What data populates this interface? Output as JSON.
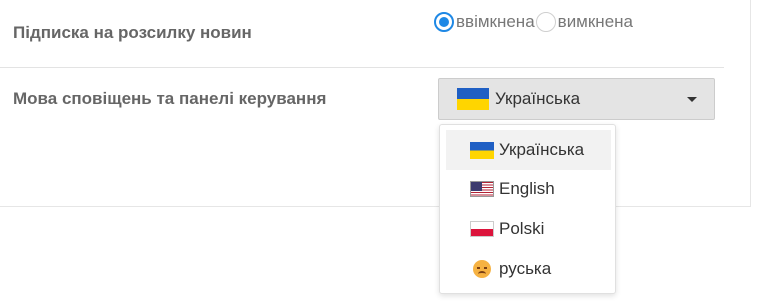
{
  "newsletter": {
    "label": "Підписка на розсилку новин",
    "options": [
      {
        "label": "ввімкнена",
        "checked": true
      },
      {
        "label": "вимкнена",
        "checked": false
      }
    ]
  },
  "language": {
    "label": "Мова сповіщень та панелі керування",
    "selected": {
      "label": "Українська",
      "icon": "flag-ukraine-icon"
    },
    "dropdown_open": true,
    "options": [
      {
        "label": "Українська",
        "icon": "flag-ukraine-icon",
        "highlighted": true
      },
      {
        "label": "English",
        "icon": "flag-usa-icon"
      },
      {
        "label": "Polski",
        "icon": "flag-poland-icon"
      },
      {
        "label": "руська",
        "icon": "disappointed-face-icon"
      }
    ]
  },
  "colors": {
    "accent": "#1e88e5",
    "label_text": "#666666",
    "select_bg": "#e4e4e4",
    "highlight_bg": "#f2f2f2"
  }
}
